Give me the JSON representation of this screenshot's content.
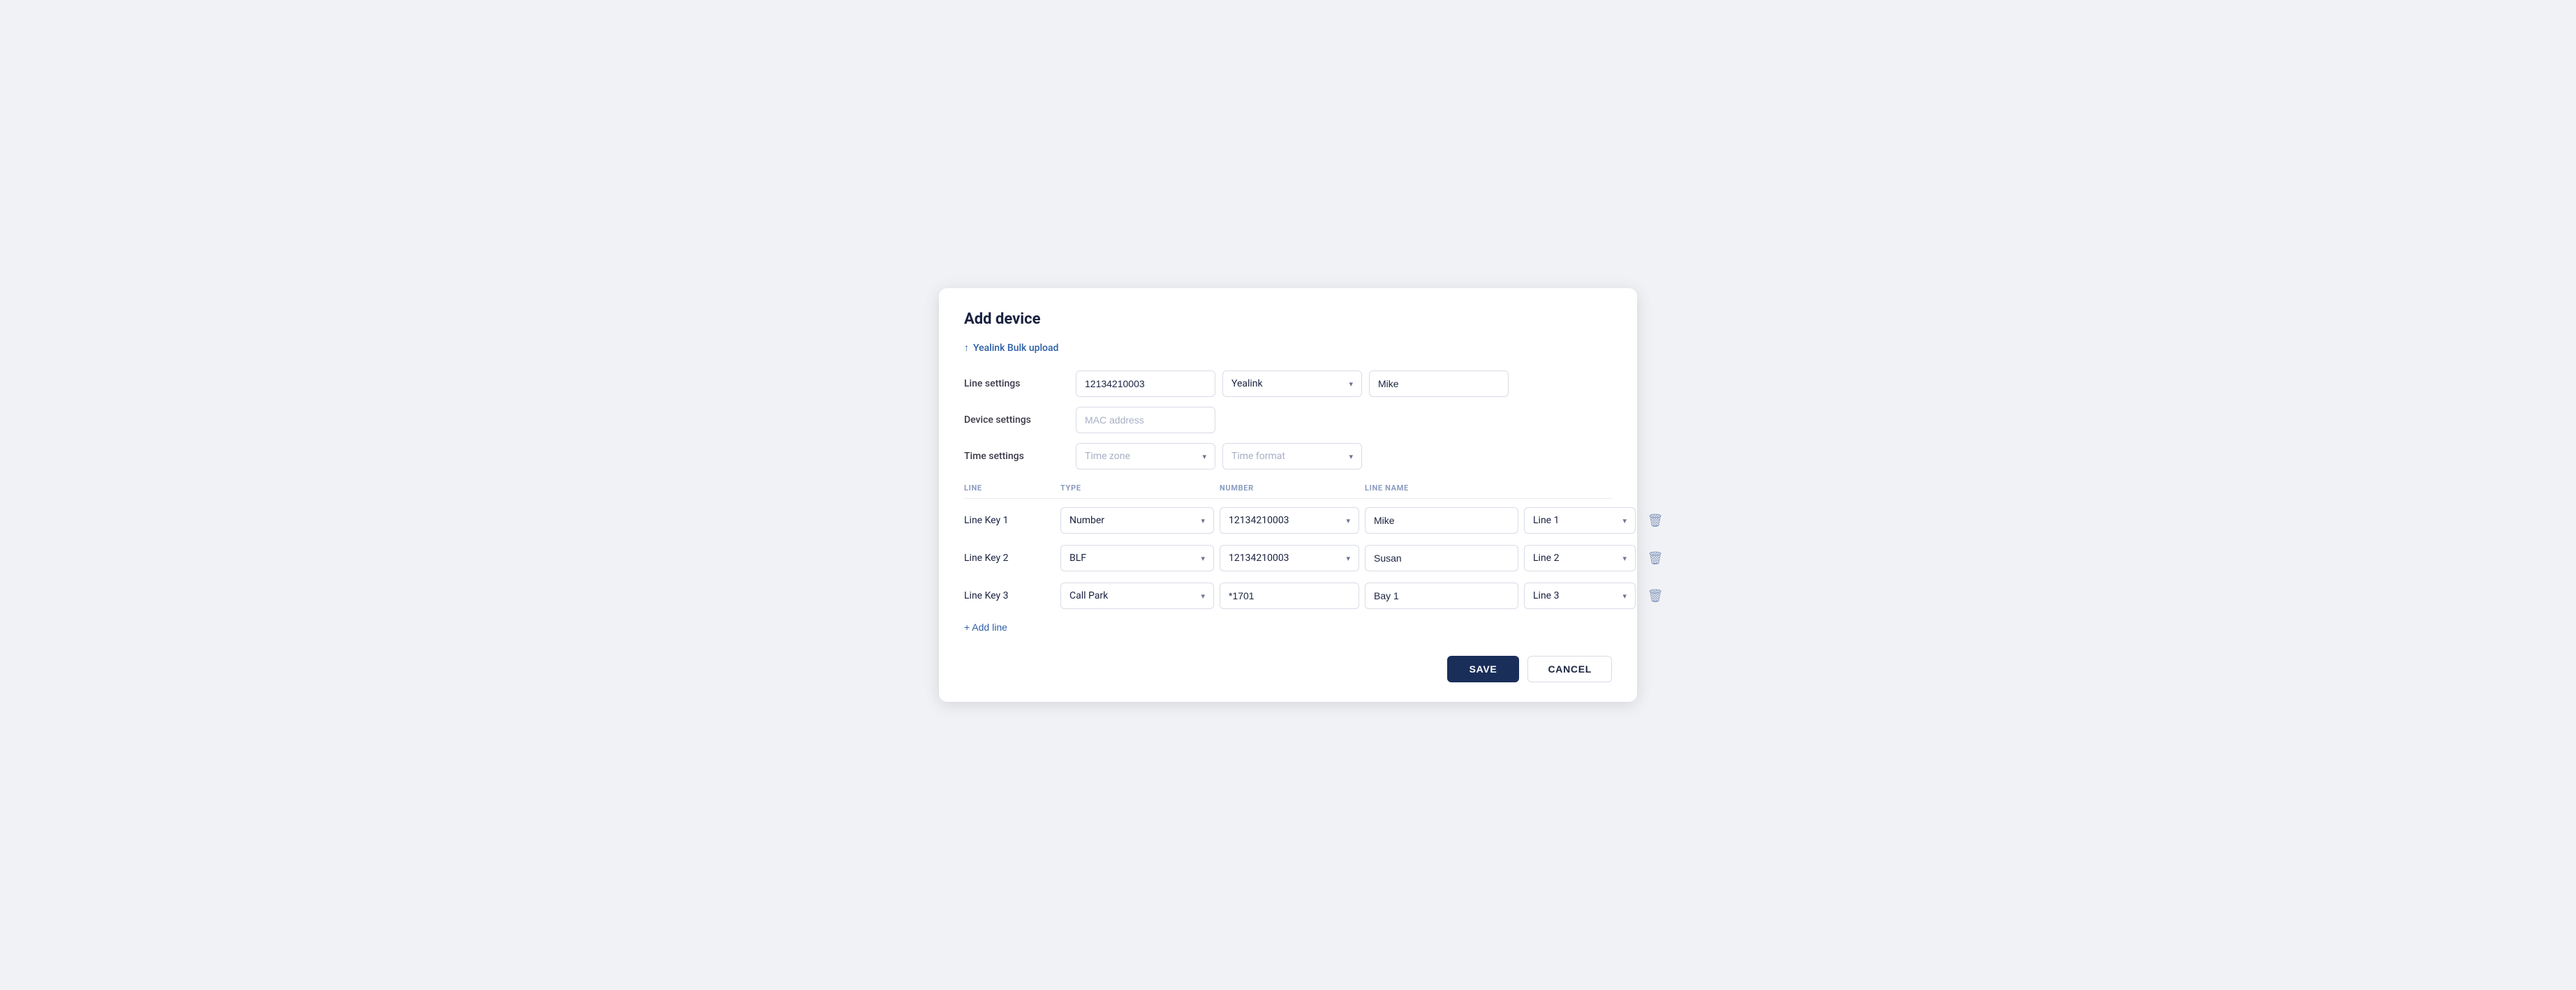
{
  "dialog": {
    "title": "Add device",
    "bulk_upload_label": "Yealink Bulk upload"
  },
  "line_settings": {
    "label": "Line settings",
    "phone_number": "12134210003",
    "brand_value": "Yealink",
    "name_value": "Mike"
  },
  "device_settings": {
    "label": "Device settings",
    "mac_placeholder": "MAC address"
  },
  "time_settings": {
    "label": "Time settings",
    "timezone_placeholder": "Time zone",
    "timeformat_placeholder": "Time format"
  },
  "table": {
    "columns": {
      "line": "LINE",
      "type": "TYPE",
      "number": "NUMBER",
      "line_name": "LINE NAME"
    },
    "rows": [
      {
        "line": "Line Key 1",
        "type": "Number",
        "number": "12134210003",
        "line_name": "Mike",
        "line_label": "Line 1"
      },
      {
        "line": "Line Key 2",
        "type": "BLF",
        "number": "12134210003",
        "line_name": "Susan",
        "line_label": "Line 2"
      },
      {
        "line": "Line Key 3",
        "type": "Call Park",
        "number": "*1701",
        "line_name": "Bay 1",
        "line_label": "Line 3"
      }
    ]
  },
  "add_line_label": "+ Add line",
  "footer": {
    "save_label": "SAVE",
    "cancel_label": "CANCEL"
  },
  "icons": {
    "upload": "↑",
    "chevron": "▾",
    "trash": "🗑"
  }
}
